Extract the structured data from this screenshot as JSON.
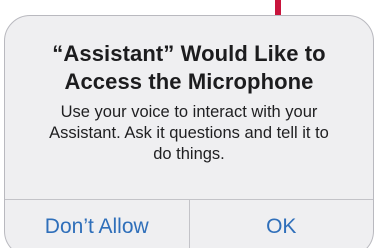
{
  "dialog": {
    "title_line1": "“Assistant” Would Like to",
    "title_line2": "Access the Microphone",
    "message_line1": "Use your voice to interact with your",
    "message_line2": "Assistant. Ask it questions and tell it to",
    "message_line3": "do things.",
    "deny_label": "Don’t Allow",
    "allow_label": "OK"
  },
  "colors": {
    "accent": "#2f6fba",
    "dialog_background": "#efeff1",
    "marker": "#c8143c"
  }
}
